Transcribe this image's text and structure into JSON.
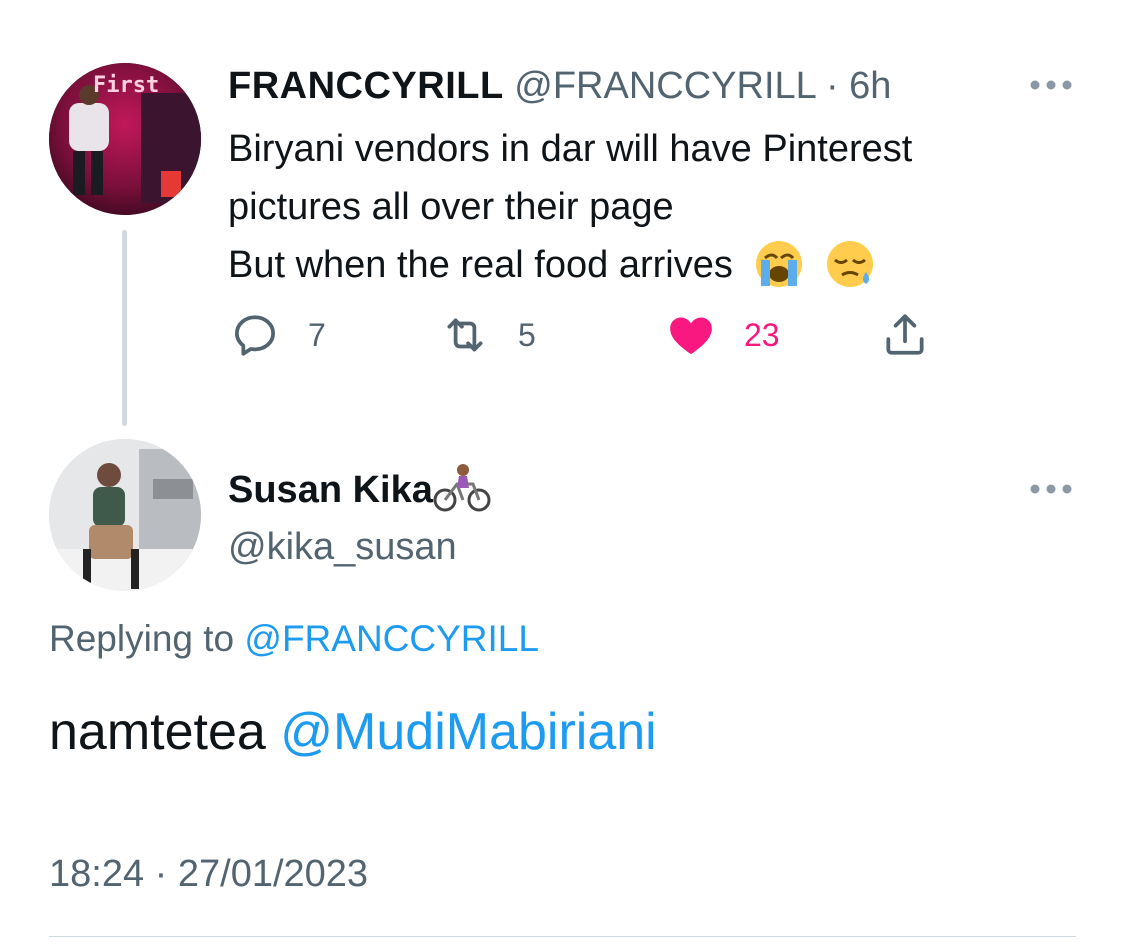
{
  "parent_tweet": {
    "display_name": "FRANCCYRILL",
    "handle": "@FRANCCYRILL",
    "separator": "·",
    "time_ago": "6h",
    "avatar_sign_text": "First",
    "text_lines": [
      "Biryani vendors in dar will have Pinterest",
      "pictures all over their page",
      "But when the real food arrives"
    ],
    "emojis": [
      "loudly-crying-face",
      "sleepy-face"
    ],
    "actions": {
      "reply_count": "7",
      "retweet_count": "5",
      "like_count": "23",
      "liked": true
    },
    "more_icon": "more-horizontal-icon"
  },
  "reply_tweet": {
    "display_name": "Susan Kika",
    "name_emoji": "woman-biking",
    "handle": "@kika_susan",
    "replying_label": "Replying to",
    "replying_to": "@FRANCCYRILL",
    "text": "namtetea",
    "mention": "@MudiMabiriani",
    "timestamp": "18:24 · 27/01/2023",
    "more_icon": "more-horizontal-icon"
  },
  "colors": {
    "text": "#0f1419",
    "secondary": "#536471",
    "link": "#1d9bf0",
    "like": "#f91880",
    "divider": "#cfd9de"
  }
}
